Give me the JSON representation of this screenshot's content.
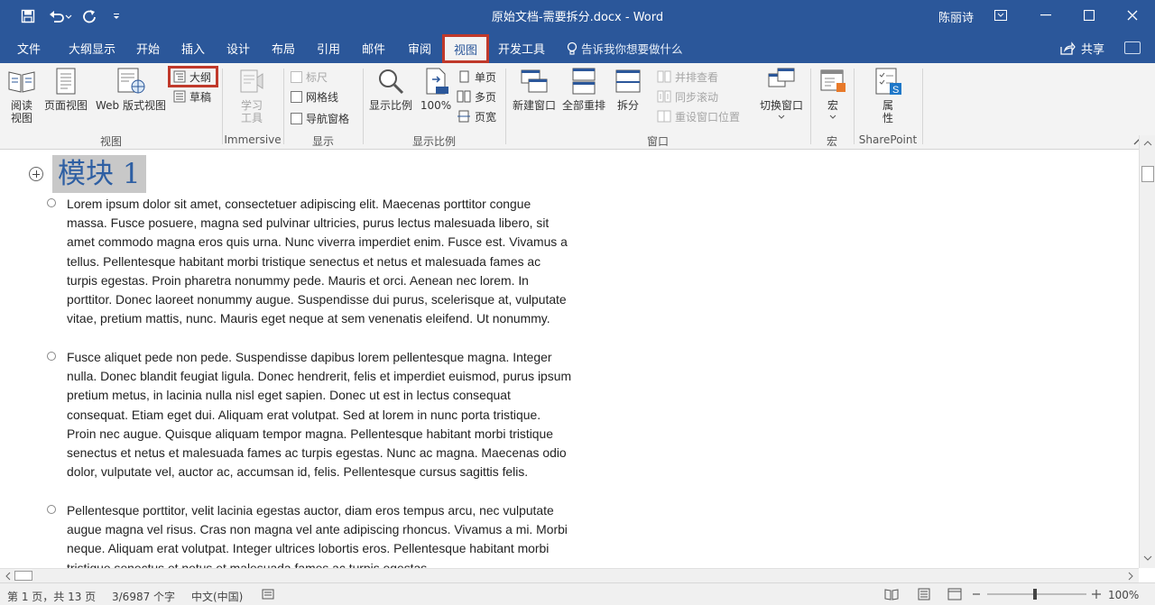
{
  "titlebar": {
    "doc_title": "原始文档-需要拆分.docx  -  Word",
    "user": "陈丽诗"
  },
  "tabs": [
    "文件",
    "大纲显示",
    "开始",
    "插入",
    "设计",
    "布局",
    "引用",
    "邮件",
    "审阅",
    "视图",
    "开发工具"
  ],
  "active_tab": "视图",
  "tell_me": "告诉我你想要做什么",
  "share": "共享",
  "ribbon": {
    "views": {
      "label": "视图",
      "read_mode": "阅读\n视图",
      "print_layout": "页面视图",
      "web_layout": "Web 版式视图",
      "outline": "大纲",
      "draft": "草稿"
    },
    "immersive": {
      "label": "Immersive",
      "learning_tools": "学习\n工具"
    },
    "show": {
      "label": "显示",
      "ruler": "标尺",
      "gridlines": "网格线",
      "nav_pane": "导航窗格"
    },
    "zoom": {
      "label": "显示比例",
      "zoom": "显示比例",
      "hundred": "100%",
      "one_page": "单页",
      "multi_page": "多页",
      "page_width": "页宽"
    },
    "window": {
      "label": "窗口",
      "new_window": "新建窗口",
      "arrange_all": "全部重排",
      "split": "拆分",
      "side_by_side": "并排查看",
      "sync_scroll": "同步滚动",
      "reset_position": "重设窗口位置",
      "switch_windows": "切换窗口"
    },
    "macros": {
      "label": "宏",
      "macros": "宏"
    },
    "sharepoint": {
      "label": "SharePoint",
      "properties": "属\n性"
    }
  },
  "document": {
    "heading": "模块 1",
    "paragraphs": [
      "Lorem ipsum dolor sit amet, consectetuer adipiscing elit. Maecenas porttitor congue massa. Fusce posuere, magna sed pulvinar ultricies, purus lectus malesuada libero, sit amet commodo magna eros quis urna. Nunc viverra imperdiet enim. Fusce est. Vivamus a tellus. Pellentesque habitant morbi tristique senectus et netus et malesuada fames ac turpis egestas. Proin pharetra nonummy pede. Mauris et orci. Aenean nec lorem. In porttitor. Donec laoreet nonummy augue. Suspendisse dui purus, scelerisque at, vulputate vitae, pretium mattis, nunc. Mauris eget neque at sem venenatis eleifend. Ut nonummy.",
      "Fusce aliquet pede non pede. Suspendisse dapibus lorem pellentesque magna. Integer nulla. Donec blandit feugiat ligula. Donec hendrerit, felis et imperdiet euismod, purus ipsum pretium metus, in lacinia nulla nisl eget sapien. Donec ut est in lectus consequat consequat. Etiam eget dui. Aliquam erat volutpat. Sed at lorem in nunc porta tristique. Proin nec augue. Quisque aliquam tempor magna. Pellentesque habitant morbi tristique senectus et netus et malesuada fames ac turpis egestas. Nunc ac magna. Maecenas odio dolor, vulputate vel, auctor ac, accumsan id, felis. Pellentesque cursus sagittis felis.",
      "Pellentesque porttitor, velit lacinia egestas auctor, diam eros tempus arcu, nec vulputate augue magna vel risus. Cras non magna vel ante adipiscing rhoncus. Vivamus a mi. Morbi neque. Aliquam erat volutpat. Integer ultrices lobortis eros. Pellentesque habitant morbi tristique senectus et netus et malesuada fames ac turpis egestas."
    ]
  },
  "status": {
    "page": "第 1 页，共 13 页",
    "words": "3/6987 个字",
    "language": "中文(中国)",
    "zoom": "100%"
  },
  "colors": {
    "brand": "#2b579a",
    "highlight": "#c0392b",
    "heading": "#2e5fa3"
  }
}
